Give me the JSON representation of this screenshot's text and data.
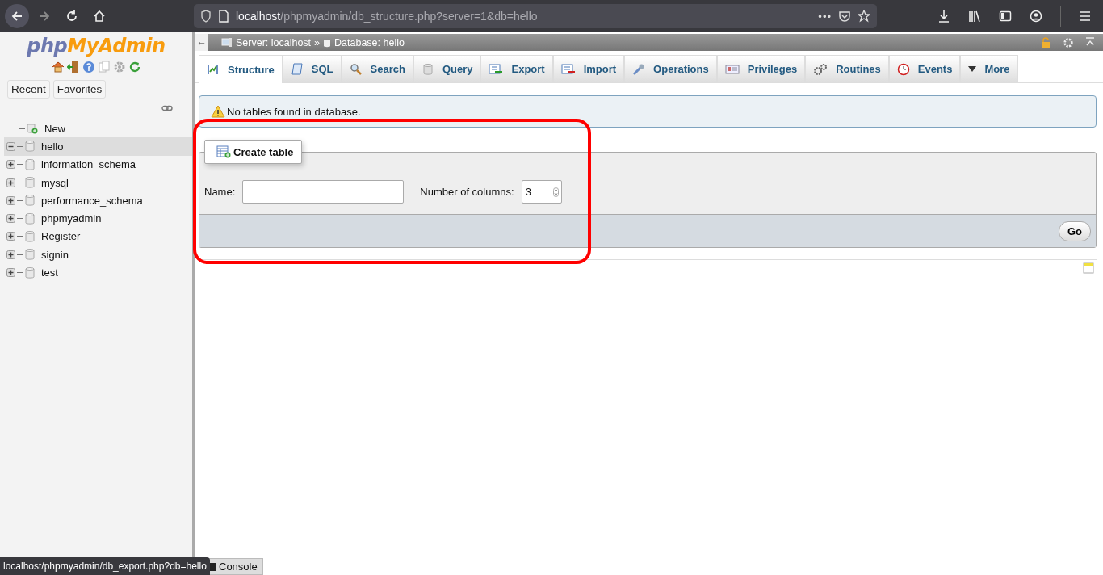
{
  "browser": {
    "url_host": "localhost",
    "url_path": "/phpmyadmin/db_structure.php?server=1&db=hello",
    "page_actions": "•••"
  },
  "sidebar": {
    "logo": {
      "part_1": "php",
      "part_2": "MyAdmin"
    },
    "buttons": [
      "Recent",
      "Favorites"
    ],
    "tree": [
      {
        "label": "New",
        "kind": "new",
        "selected": false
      },
      {
        "label": "hello",
        "kind": "database",
        "expanded": true,
        "selected": true
      },
      {
        "label": "information_schema",
        "kind": "database",
        "expanded": false,
        "selected": false
      },
      {
        "label": "mysql",
        "kind": "database",
        "expanded": false,
        "selected": false
      },
      {
        "label": "performance_schema",
        "kind": "database",
        "expanded": false,
        "selected": false
      },
      {
        "label": "phpmyadmin",
        "kind": "database",
        "expanded": false,
        "selected": false
      },
      {
        "label": "Register",
        "kind": "database",
        "expanded": false,
        "selected": false
      },
      {
        "label": "signin",
        "kind": "database",
        "expanded": false,
        "selected": false
      },
      {
        "label": "test",
        "kind": "database",
        "expanded": false,
        "selected": false
      }
    ]
  },
  "breadcrumb": {
    "back": "←",
    "server": "Server: localhost",
    "separator": "»",
    "database": "Database: hello"
  },
  "tabs": [
    {
      "label": "Structure",
      "kind": "structure",
      "selected": true
    },
    {
      "label": "SQL",
      "kind": "sql",
      "selected": false
    },
    {
      "label": "Search",
      "kind": "search",
      "selected": false
    },
    {
      "label": "Query",
      "kind": "query",
      "selected": false
    },
    {
      "label": "Export",
      "kind": "export",
      "selected": false
    },
    {
      "label": "Import",
      "kind": "import",
      "selected": false
    },
    {
      "label": "Operations",
      "kind": "operations",
      "selected": false
    },
    {
      "label": "Privileges",
      "kind": "privileges",
      "selected": false
    },
    {
      "label": "Routines",
      "kind": "routines",
      "selected": false
    },
    {
      "label": "Events",
      "kind": "events",
      "selected": false
    },
    {
      "label": "More",
      "kind": "more",
      "selected": false
    }
  ],
  "notice": "No tables found in database.",
  "create_table": {
    "legend": "Create table",
    "name_label": "Name:",
    "columns_label": "Number of columns:",
    "columns_value": "3",
    "go": "Go"
  },
  "status_link": "localhost/phpmyadmin/db_export.php?db=hello",
  "console": "Console"
}
